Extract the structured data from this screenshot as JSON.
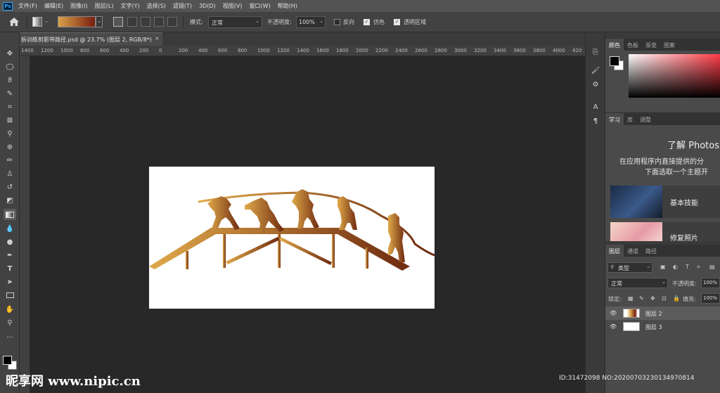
{
  "menubar": {
    "logo": "Ps",
    "items": [
      "文件(F)",
      "编辑(E)",
      "图像(I)",
      "图层(L)",
      "文字(Y)",
      "选择(S)",
      "滤镜(T)",
      "3D(D)",
      "视图(V)",
      "窗口(W)",
      "帮助(H)"
    ]
  },
  "options": {
    "mode_label": "模式:",
    "mode_value": "正常",
    "opacity_label": "不透明度:",
    "opacity_value": "100%",
    "reverse_label": "反向",
    "reverse_checked": false,
    "dither_label": "仿色",
    "dither_checked": true,
    "transparency_label": "透明区域",
    "transparency_checked": true,
    "gradient_colors": [
      "#d8a24a",
      "#7a1d10"
    ]
  },
  "document": {
    "tab_title": "拆训练剪影带路径.psd @ 23.7% (图层 2, RGB/8*)",
    "close_glyph": "×"
  },
  "ruler": {
    "ticks": [
      "1400",
      "1200",
      "1000",
      "800",
      "600",
      "400",
      "200",
      "0",
      "200",
      "400",
      "600",
      "800",
      "1000",
      "1200",
      "1400",
      "1600",
      "1800",
      "2000",
      "2200",
      "2400",
      "2600",
      "2800",
      "3000",
      "3200",
      "3400",
      "3600",
      "3800",
      "4000",
      "420"
    ]
  },
  "panels": {
    "color_tabs": [
      "颜色",
      "色板",
      "渐变",
      "图案"
    ],
    "learn_tabs": [
      "学习",
      "库",
      "调整"
    ],
    "learn_title": "了解 Photosh",
    "learn_desc_1": "在应用程序内直接提供的分",
    "learn_desc_2": "下面选取一个主题开",
    "cards": [
      {
        "label": "基本技能"
      },
      {
        "label": "修复照片"
      }
    ],
    "layer_tabs": [
      "图层",
      "通道",
      "路径"
    ],
    "filter_label": "类型",
    "blend_mode": "正常",
    "opacity_label": "不透明度:",
    "opacity_value": "100%",
    "lock_label": "锁定:",
    "fill_label": "填充:",
    "fill_value": "100%",
    "layers": [
      {
        "name": "图层 2",
        "selected": true
      },
      {
        "name": "图层 3",
        "selected": false
      }
    ]
  },
  "watermark": {
    "site": "昵享网 www.nipic.cn",
    "id": "ID:31472098 NO:20200703230134970814"
  },
  "colors": {
    "accent": "#31a8ff",
    "silhouette_light": "#e0a94a",
    "silhouette_dark": "#6e2a10"
  }
}
